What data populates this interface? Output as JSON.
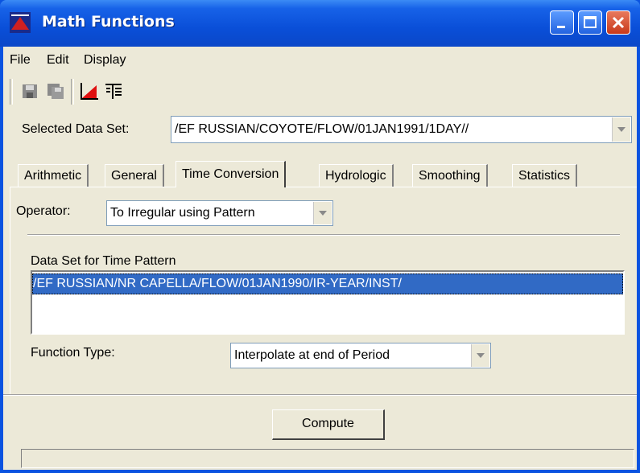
{
  "window": {
    "title": "Math Functions"
  },
  "menu": {
    "items": [
      "File",
      "Edit",
      "Display"
    ]
  },
  "toolbar": {
    "icons": [
      "save-icon",
      "save-as-icon",
      "plot-icon",
      "tabulate-icon"
    ]
  },
  "selected_data_set": {
    "label": "Selected Data Set:",
    "value": "/EF RUSSIAN/COYOTE/FLOW/01JAN1991/1DAY//"
  },
  "tabs": [
    "Arithmetic",
    "General",
    "Time Conversion",
    "Hydrologic",
    "Smoothing",
    "Statistics"
  ],
  "active_tab": "Time Conversion",
  "operator": {
    "label": "Operator:",
    "value": "To Irregular using Pattern"
  },
  "time_pattern": {
    "label": "Data Set for Time Pattern",
    "items": [
      "/EF RUSSIAN/NR CAPELLA/FLOW/01JAN1990/IR-YEAR/INST/"
    ]
  },
  "function_type": {
    "label": "Function Type:",
    "value": "Interpolate at end of Period"
  },
  "compute_button": {
    "label": "Compute"
  },
  "colors": {
    "titlebar": "#0a53e0",
    "selection": "#316ac5",
    "window_bg": "#ece9d8"
  }
}
